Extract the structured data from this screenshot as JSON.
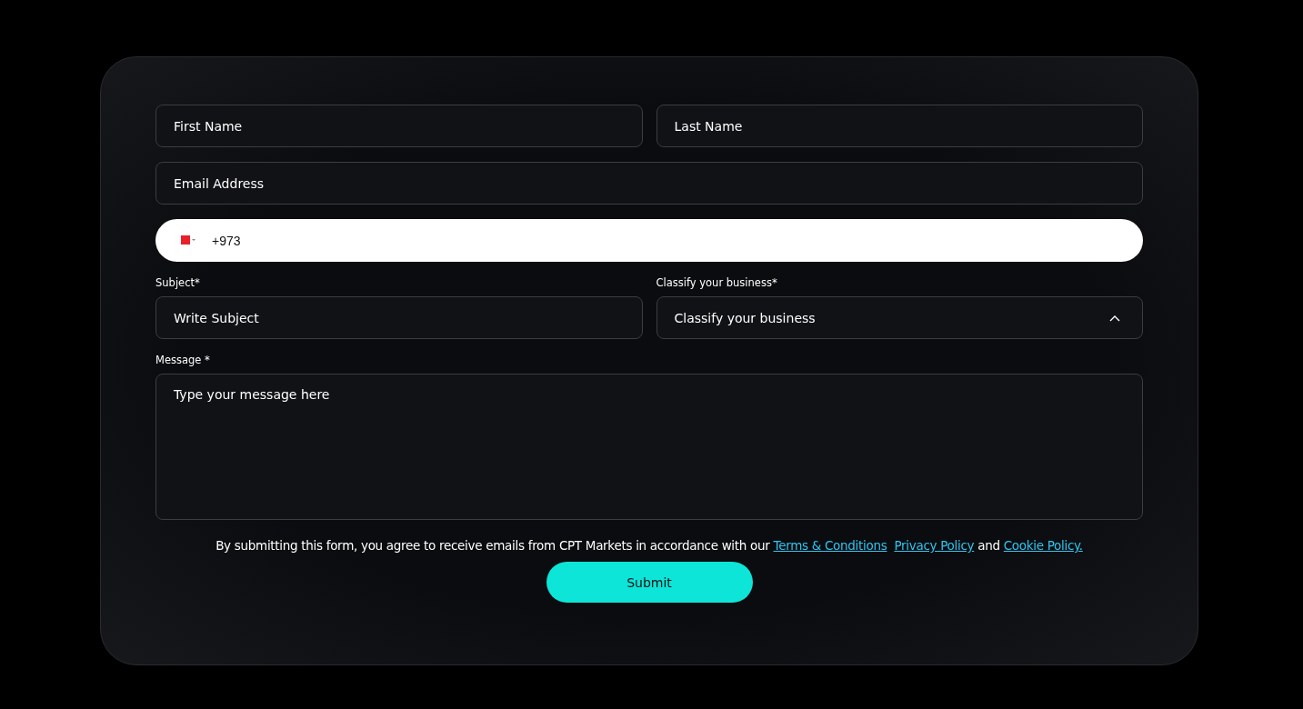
{
  "form": {
    "first_name": {
      "placeholder": "First Name"
    },
    "last_name": {
      "placeholder": "Last Name"
    },
    "email": {
      "placeholder": "Email Address"
    },
    "phone": {
      "value": "+973"
    },
    "subject": {
      "label": "Subject*",
      "placeholder": "Write Subject"
    },
    "business": {
      "label": "Classify your business*",
      "placeholder": "Classify your business"
    },
    "message": {
      "label": "Message *",
      "placeholder": "Type your message here"
    },
    "consent": [
      {
        "kind": "text",
        "text": "By submitting this form, you agree to receive emails from CPT Markets in accordance with our "
      },
      {
        "kind": "link",
        "text": "Terms & Conditions"
      },
      {
        "kind": "link",
        "text": "Privacy Policy"
      },
      {
        "kind": "text",
        "text": " and "
      },
      {
        "kind": "link",
        "text": "Cookie Policy."
      }
    ],
    "submit": "Submit"
  }
}
